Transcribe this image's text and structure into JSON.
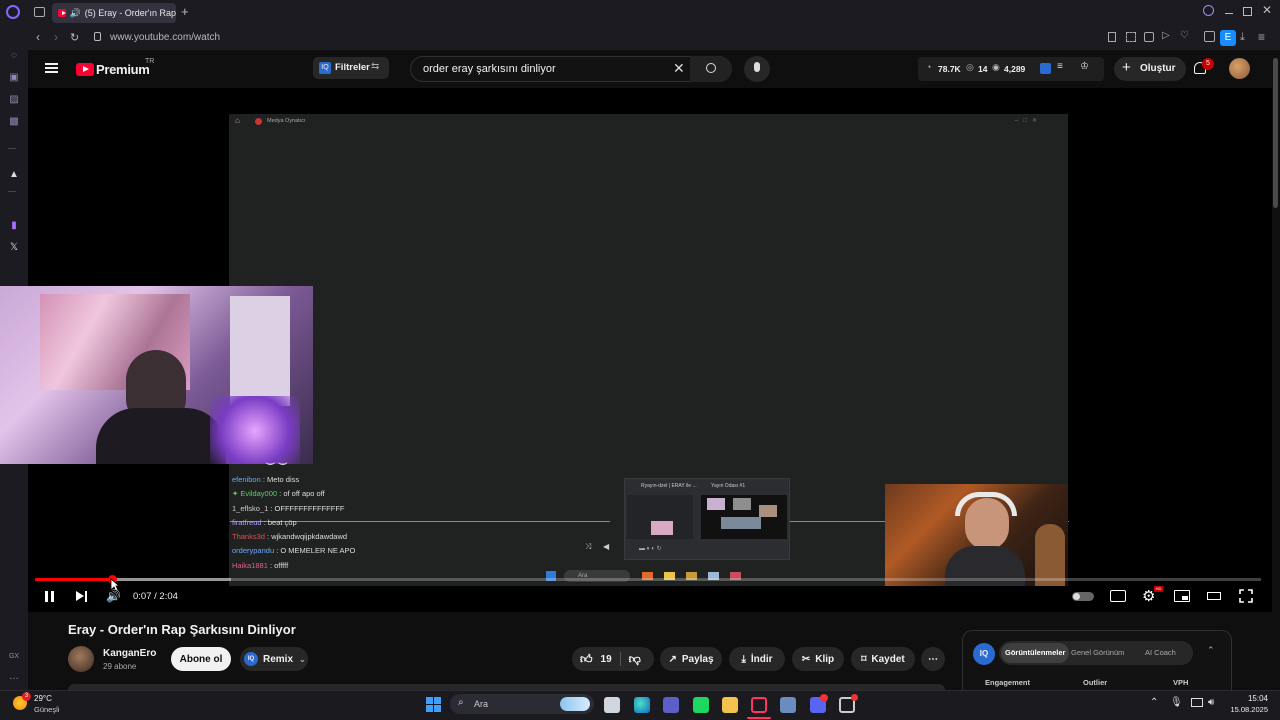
{
  "browser": {
    "tab_title": "(5) Eray - Order'ın Rap",
    "url": "www.youtube.com/watch",
    "extension_badge": "E"
  },
  "youtube": {
    "logo_text": "Premium",
    "logo_region": "TR",
    "filters_label": "Filtreler",
    "search_value": "order eray şarkısını dinliyor",
    "stats": {
      "views": "78.7K",
      "eye": "14",
      "other": "4,289"
    },
    "create_label": "Oluştur",
    "notifications_count": "5"
  },
  "video_player": {
    "current_time": "0:07",
    "duration": "2:04",
    "time_display": "0:07 / 2:04",
    "progress_fraction": 0.063,
    "buffered_fraction": 0.16,
    "inner_window_title": "Medya Oynatıcı",
    "chat_lines": [
      {
        "user": "efenibon",
        "msg": " : Meto diss",
        "color": "#6aa7ff"
      },
      {
        "user": "Evilday000",
        "msg": " : of off apo off",
        "color": "#5ad35a"
      },
      {
        "user": "1_eflsko_1",
        "msg": " : OFFFFFFFFFFFFFF",
        "color": "#cfcfcf"
      },
      {
        "user": "firatfreud",
        "msg": " : beat çöp",
        "color": "#b49cff"
      },
      {
        "user": "Thanks3d",
        "msg": " : wjkandwqijpkdawdawd",
        "color": "#e05050"
      },
      {
        "user": "orderypandu",
        "msg": " : O MEMELER NE APO",
        "color": "#6aa7ff"
      },
      {
        "user": "Haika1881",
        "msg": " : offfff",
        "color": "#e06090"
      }
    ],
    "mini_window_1": "Ryayın-dzel | ERAY ile ...",
    "mini_window_2": "Yayın Odası #1",
    "taskbar_search": "Ara"
  },
  "video_info": {
    "title": "Eray - Order'ın Rap Şarkısını Dinliyor",
    "channel_name": "KanganEro",
    "subscribers": "29 abone",
    "subscribe_label": "Abone ol",
    "remix_label": "Remix",
    "like_count": "19",
    "share_label": "Paylaş",
    "download_label": "İndir",
    "clip_label": "Klip",
    "save_label": "Kaydet"
  },
  "side_panel": {
    "badge": "IQ",
    "tabs": [
      "Görüntülenmeler",
      "Genel Görünüm",
      "AI Coach"
    ],
    "columns": [
      "Engagement",
      "Outlier",
      "VPH"
    ]
  },
  "sidebar_extra": {
    "gx": "GX"
  },
  "taskbar": {
    "weather_temp": "29°C",
    "weather_desc": "Güneşli",
    "weather_badge": "3",
    "search_label": "Ara",
    "time": "15:04",
    "date": "15.08.2025"
  },
  "colors": {
    "youtube_red": "#ff0033",
    "progress_red": "#ff0000",
    "background": "#0f0f0f"
  }
}
